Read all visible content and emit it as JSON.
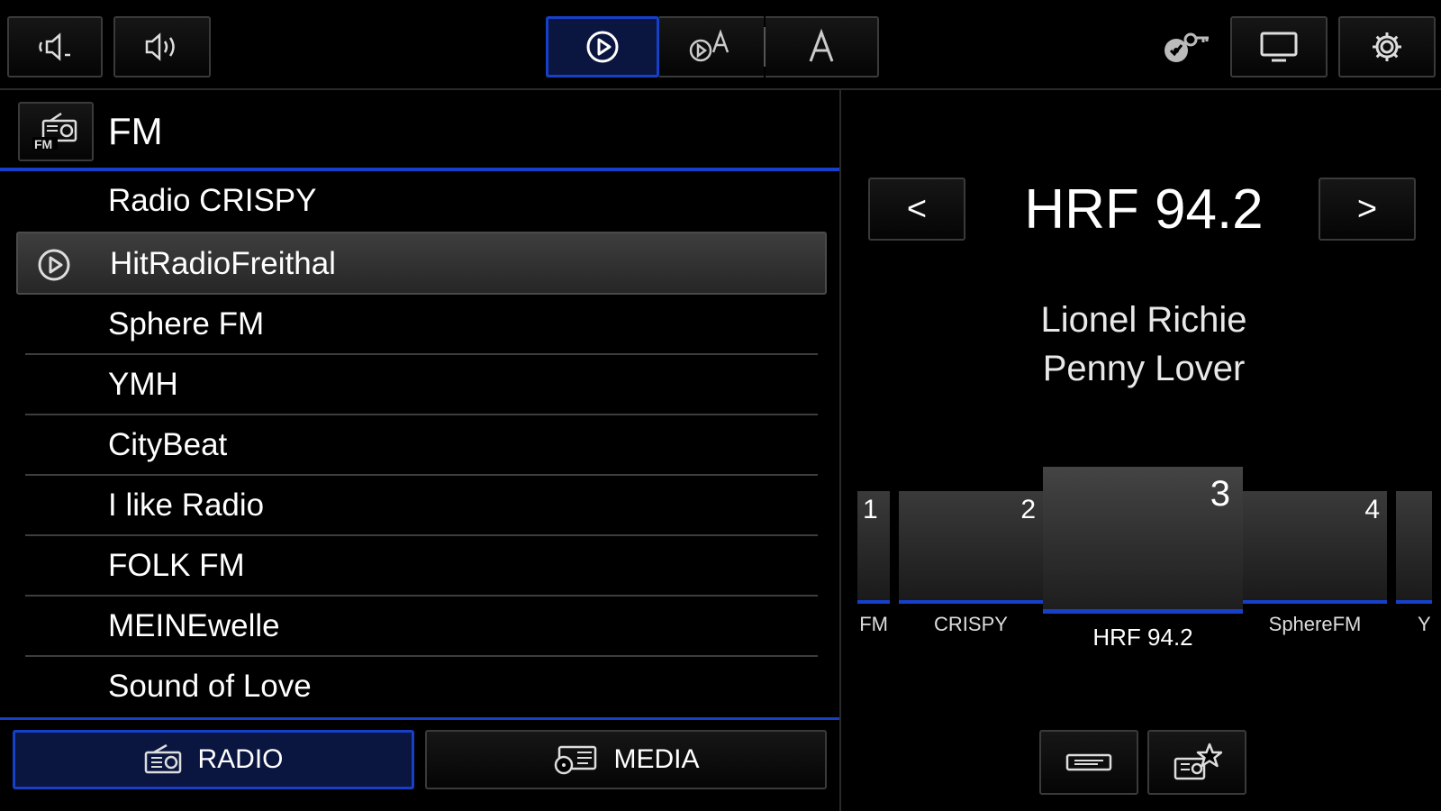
{
  "topbar": {
    "icons": [
      "volume-down-icon",
      "volume-up-icon",
      "play-icon",
      "play-announce-icon",
      "announce-icon",
      "cd-key-icon",
      "screen-icon",
      "gear-icon"
    ]
  },
  "source": {
    "band": "FM"
  },
  "stations": [
    {
      "label": "Radio CRISPY",
      "active": false
    },
    {
      "label": "HitRadioFreithal",
      "active": true
    },
    {
      "label": "Sphere FM",
      "active": false
    },
    {
      "label": "YMH",
      "active": false
    },
    {
      "label": "CityBeat",
      "active": false
    },
    {
      "label": "I like Radio",
      "active": false
    },
    {
      "label": "FOLK FM",
      "active": false
    },
    {
      "label": "MEINEwelle",
      "active": false
    },
    {
      "label": "Sound of Love",
      "active": false
    }
  ],
  "tabs": {
    "radio": "RADIO",
    "media": "MEDIA"
  },
  "now_playing": {
    "prev": "<",
    "next": ">",
    "station": "HRF 94.2",
    "artist": "Lionel Richie",
    "title": "Penny Lover"
  },
  "presets": [
    {
      "num": "1",
      "label": "FM"
    },
    {
      "num": "2",
      "label": "CRISPY"
    },
    {
      "num": "3",
      "label": "HRF 94.2"
    },
    {
      "num": "4",
      "label": "SphereFM"
    },
    {
      "num": "",
      "label": "Y"
    }
  ],
  "colors": {
    "accent": "#1740c8",
    "active_bg": "#0a1640"
  }
}
